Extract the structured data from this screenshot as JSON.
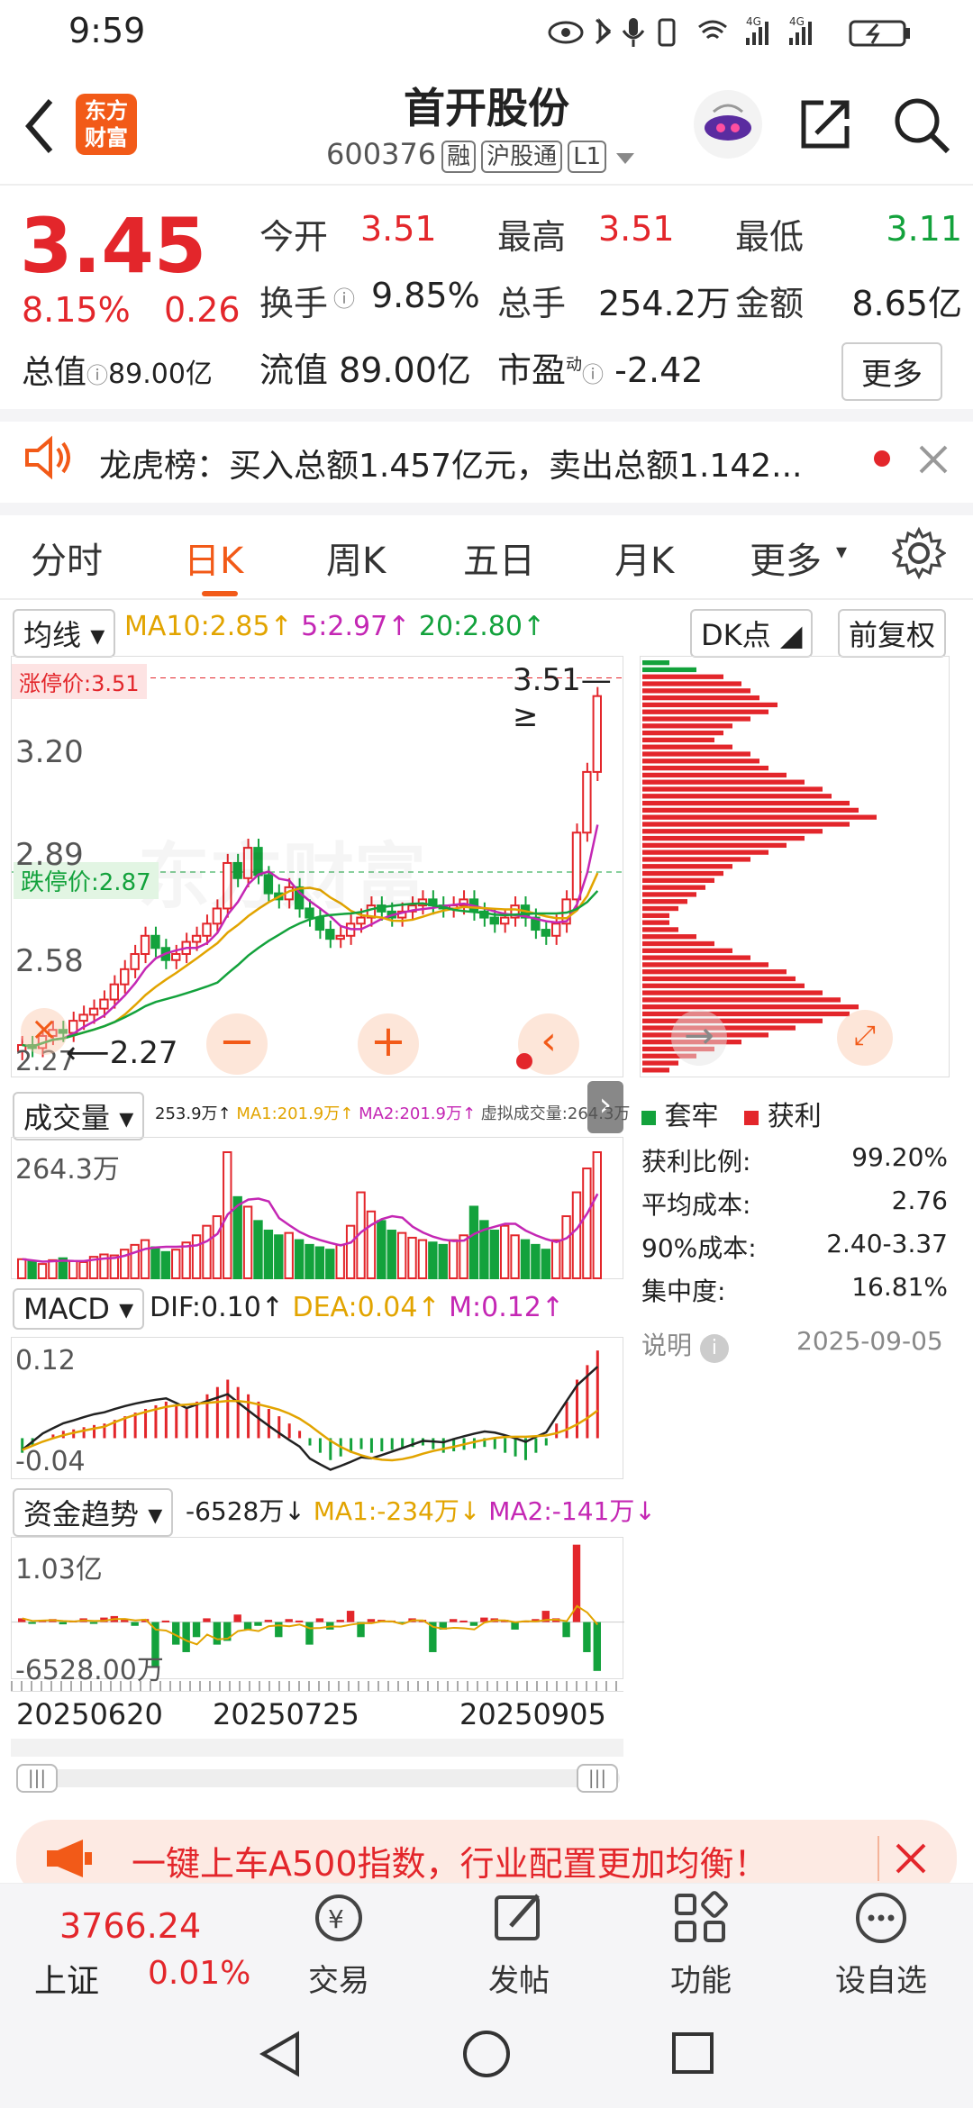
{
  "status_bar": {
    "time": "9:59",
    "sig1": "4G",
    "sig2": "4G"
  },
  "header": {
    "logo": "东方财富",
    "title": "首开股份",
    "code": "600376",
    "tags": [
      "融",
      "沪股通",
      "L1"
    ]
  },
  "quote": {
    "price": "3.45",
    "change_pct": "8.15%",
    "change": "0.26",
    "rows": [
      [
        {
          "label": "今开",
          "value": "3.51",
          "color": "red"
        },
        {
          "label": "最高",
          "value": "3.51",
          "color": "red"
        },
        {
          "label": "最低",
          "value": "3.11",
          "color": "green"
        }
      ],
      [
        {
          "label": "换手",
          "value": "9.85%"
        },
        {
          "label": "总手",
          "value": "254.2万"
        },
        {
          "label": "金额",
          "value": "8.65亿"
        }
      ]
    ],
    "total_value_label": "总值",
    "total_value": "89.00亿",
    "float_label": "流值",
    "float_value": "89.00亿",
    "pe_label": "市盈",
    "pe_sup": "动",
    "pe_value": "-2.42",
    "more": "更多"
  },
  "news": {
    "text": "龙虎榜：买入总额1.457亿元，卖出总额1.142..."
  },
  "tabs": [
    "分时",
    "日K",
    "周K",
    "五日",
    "月K",
    "更多"
  ],
  "active_tab": "日K",
  "ma_bar": {
    "select": "均线",
    "ma10": "MA10:2.85↑",
    "ma5": "5:2.97↑",
    "ma20": "20:2.80↑",
    "dk": "DK点",
    "fq": "前复权"
  },
  "kline": {
    "limit_up": "涨停价:3.51",
    "limit_down": "跌停价:2.87",
    "y_high": "3.20",
    "y_mid": "2.89",
    "y_low": "2.58",
    "y_min": "2.27",
    "last_label": "3.51",
    "min_label": "2.27",
    "watermark": "东方财富"
  },
  "volume": {
    "select": "成交量",
    "vol": "253.9万↑",
    "ma1": "MA1:201.9万↑",
    "ma2": "MA2:201.9万↑",
    "virtual": "虚拟成交量:264.3万",
    "y_max": "264.3万"
  },
  "macd": {
    "select": "MACD",
    "dif": "DIF:0.10↑",
    "dea": "DEA:0.04↑",
    "m": "M:0.12↑",
    "y_max": "0.12",
    "y_min": "-0.04"
  },
  "fund": {
    "select": "资金趋势",
    "val": "-6528万↓",
    "ma1": "MA1:-234万↓",
    "ma2": "MA2:-141万↓",
    "y_max": "1.03亿",
    "y_min": "-6528.00万"
  },
  "dates": [
    "20250620",
    "20250725",
    "20250905"
  ],
  "chips": {
    "legend_locked": "套牢",
    "legend_profit": "获利",
    "stats": [
      {
        "label": "获利比例:",
        "value": "99.20%"
      },
      {
        "label": "平均成本:",
        "value": "2.76"
      },
      {
        "label": "90%成本:",
        "value": "2.40-3.37"
      },
      {
        "label": "集中度:",
        "value": "16.81%"
      }
    ],
    "note": "说明",
    "date": "2025-09-05"
  },
  "banner": {
    "text": "一键上车A500指数，行业配置更加均衡！"
  },
  "bottom_nav": {
    "index_value": "3766.24",
    "index_name": "上证",
    "index_change": "0.01%",
    "items": [
      "交易",
      "发帖",
      "功能",
      "设自选"
    ]
  },
  "kline_series": {
    "o": [
      2.28,
      2.3,
      2.29,
      2.33,
      2.35,
      2.34,
      2.38,
      2.4,
      2.42,
      2.45,
      2.5,
      2.55,
      2.6,
      2.66,
      2.62,
      2.58,
      2.6,
      2.64,
      2.66,
      2.7,
      2.75,
      2.9,
      2.85,
      2.95,
      2.86,
      2.8,
      2.78,
      2.82,
      2.75,
      2.72,
      2.68,
      2.65,
      2.66,
      2.7,
      2.72,
      2.76,
      2.74,
      2.72,
      2.74,
      2.76,
      2.78,
      2.76,
      2.75,
      2.76,
      2.78,
      2.74,
      2.72,
      2.7,
      2.72,
      2.76,
      2.72,
      2.68,
      2.66,
      2.7,
      2.78,
      3.0,
      3.2
    ],
    "c": [
      2.3,
      2.29,
      2.33,
      2.35,
      2.34,
      2.38,
      2.4,
      2.42,
      2.45,
      2.5,
      2.55,
      2.6,
      2.66,
      2.62,
      2.58,
      2.6,
      2.64,
      2.66,
      2.7,
      2.75,
      2.9,
      2.85,
      2.95,
      2.86,
      2.8,
      2.78,
      2.82,
      2.75,
      2.72,
      2.68,
      2.65,
      2.66,
      2.7,
      2.72,
      2.76,
      2.74,
      2.72,
      2.74,
      2.76,
      2.78,
      2.76,
      2.75,
      2.76,
      2.78,
      2.74,
      2.72,
      2.7,
      2.72,
      2.76,
      2.72,
      2.68,
      2.66,
      2.7,
      2.78,
      3.0,
      3.2,
      3.45
    ],
    "vol": [
      40,
      35,
      30,
      38,
      42,
      36,
      34,
      45,
      50,
      48,
      60,
      70,
      80,
      65,
      55,
      60,
      75,
      90,
      110,
      130,
      264,
      170,
      150,
      120,
      100,
      90,
      95,
      80,
      70,
      65,
      60,
      70,
      110,
      180,
      140,
      120,
      100,
      95,
      85,
      80,
      75,
      70,
      80,
      90,
      150,
      120,
      100,
      110,
      90,
      80,
      70,
      60,
      80,
      130,
      180,
      230,
      264
    ],
    "macd": [
      -0.02,
      -0.01,
      0.0,
      0.005,
      0.01,
      0.012,
      0.015,
      0.018,
      0.02,
      0.025,
      0.03,
      0.035,
      0.04,
      0.045,
      0.05,
      0.045,
      0.04,
      0.05,
      0.06,
      0.07,
      0.08,
      0.07,
      0.06,
      0.05,
      0.04,
      0.03,
      0.02,
      0.01,
      -0.01,
      -0.02,
      -0.03,
      -0.025,
      -0.02,
      -0.015,
      -0.02,
      -0.018,
      -0.016,
      -0.014,
      -0.012,
      -0.01,
      -0.015,
      -0.02,
      -0.018,
      -0.016,
      -0.014,
      -0.012,
      -0.015,
      -0.02,
      -0.025,
      -0.03,
      -0.02,
      -0.01,
      0.02,
      0.05,
      0.08,
      0.1,
      0.12
    ],
    "fund": [
      0.05,
      -0.02,
      0.03,
      0.04,
      -0.03,
      0.02,
      0.05,
      -0.01,
      0.06,
      0.08,
      0.03,
      -0.05,
      0.04,
      -0.6,
      0.02,
      -0.3,
      -0.4,
      -0.2,
      0.05,
      -0.3,
      -0.25,
      0.1,
      -0.1,
      -0.05,
      0.03,
      -0.2,
      0.04,
      0.02,
      -0.3,
      0.05,
      -0.1,
      0.03,
      0.15,
      -0.2,
      0.04,
      0.03,
      0.02,
      -0.02,
      0.05,
      0.03,
      -0.4,
      -0.1,
      0.04,
      0.02,
      -0.05,
      0.06,
      0.05,
      0.03,
      -0.1,
      0.02,
      0.04,
      0.15,
      0.05,
      -0.2,
      1.03,
      -0.4,
      -0.65
    ]
  },
  "chip_bars": [
    30,
    60,
    90,
    110,
    120,
    130,
    150,
    140,
    120,
    100,
    90,
    80,
    100,
    120,
    130,
    140,
    160,
    180,
    200,
    210,
    230,
    240,
    260,
    230,
    200,
    180,
    160,
    140,
    120,
    100,
    90,
    80,
    70,
    60,
    50,
    40,
    30,
    30,
    40,
    60,
    80,
    100,
    120,
    140,
    160,
    170,
    180,
    200,
    220,
    240,
    230,
    200,
    170,
    140,
    110,
    80,
    60,
    40,
    30
  ]
}
